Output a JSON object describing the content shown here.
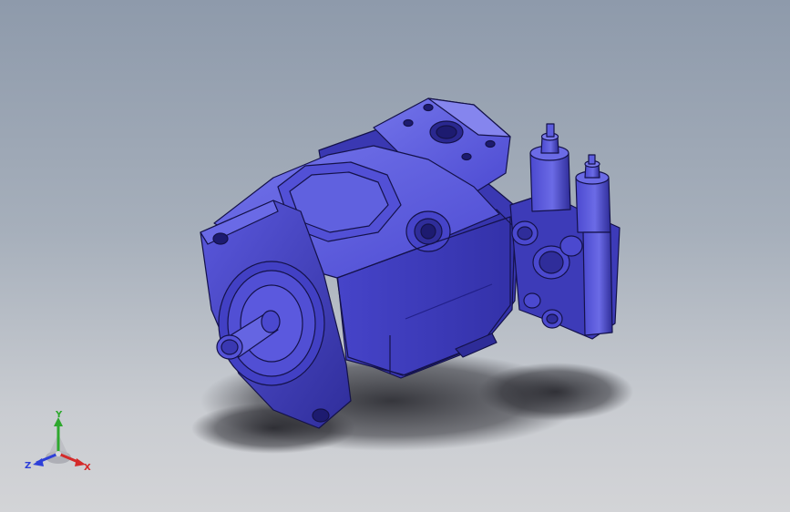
{
  "viewport": {
    "background_top": "#8e9aab",
    "background_bottom": "#d3d4d7",
    "model_color": "#4b49cf",
    "model_highlight": "#6a6ae6",
    "model_shadow": "#2a2890",
    "edge_color": "#14124a"
  },
  "triad": {
    "x_label": "X",
    "y_label": "Y",
    "z_label": "Z",
    "x_color": "#d42a2a",
    "y_color": "#2ea82e",
    "z_color": "#2d3fd8"
  }
}
